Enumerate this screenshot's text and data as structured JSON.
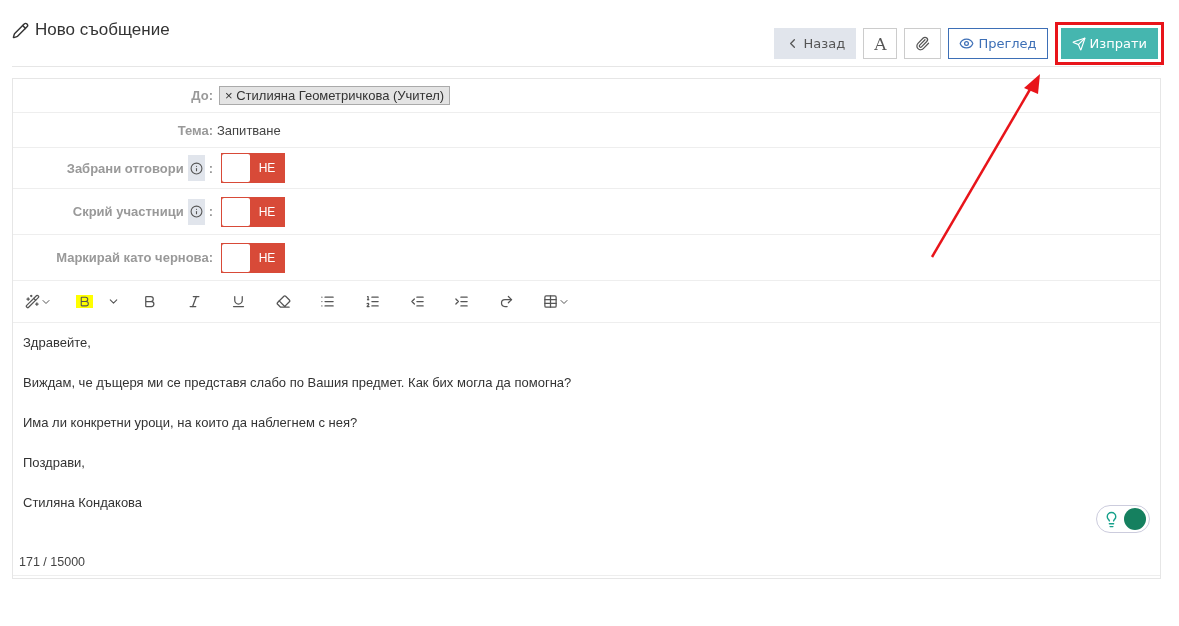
{
  "header": {
    "title": "Ново съобщение"
  },
  "actions": [
    {
      "kind": "back",
      "label": "Назад"
    },
    {
      "kind": "font",
      "label": "A"
    },
    {
      "kind": "attach"
    },
    {
      "kind": "preview",
      "label": "Преглед"
    },
    {
      "kind": "send",
      "label": "Изпрати",
      "highlighted": true
    }
  ],
  "form": {
    "to": {
      "label": "До:",
      "recipients": [
        {
          "remove": "×",
          "name": "Стилияна Геометричкова (Учител)"
        }
      ]
    },
    "subject": {
      "label": "Тема:",
      "value": "Запитване"
    },
    "toggles": [
      {
        "label": "Забрани отговори",
        "info": true,
        "colon": ":",
        "on": false,
        "state_text": "НЕ"
      },
      {
        "label": "Скрий участници",
        "info": true,
        "colon": ":",
        "on": false,
        "state_text": "НЕ"
      },
      {
        "label": "Маркирай като чернова:",
        "info": false,
        "on": false,
        "state_text": "НЕ"
      }
    ]
  },
  "editor": {
    "toolbar": [
      {
        "kind": "magic"
      },
      {
        "kind": "highlight"
      },
      {
        "kind": "bold"
      },
      {
        "kind": "italic"
      },
      {
        "kind": "underline"
      },
      {
        "kind": "eraser"
      },
      {
        "kind": "bullets"
      },
      {
        "kind": "numbers"
      },
      {
        "kind": "outdent"
      },
      {
        "kind": "indent"
      },
      {
        "kind": "redo"
      },
      {
        "kind": "table"
      }
    ],
    "paragraphs": [
      "Здравейте,",
      "Виждам, че дъщеря ми се представя слабо по Вашия предмет. Как бих могла да помогна?",
      "Има ли конкретни уроци, на които да наблегнем с нея?",
      "Поздрави,",
      "Стиляна Кондакова"
    ],
    "counter": "171 / 15000"
  }
}
